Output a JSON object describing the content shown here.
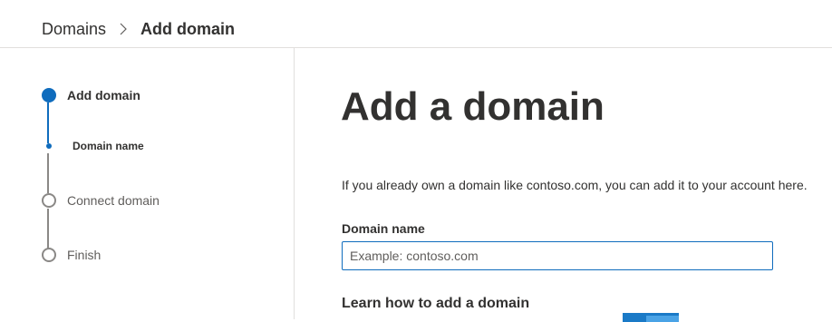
{
  "breadcrumb": {
    "root": "Domains",
    "current": "Add domain"
  },
  "steps": [
    {
      "label": "Add domain",
      "state": "active"
    },
    {
      "label": "Domain name",
      "state": "active-substep"
    },
    {
      "label": "Connect domain",
      "state": "pending"
    },
    {
      "label": "Finish",
      "state": "pending"
    }
  ],
  "main": {
    "title": "Add a domain",
    "description": "If you already own a domain like contoso.com, you can add it to your account here.",
    "field_label": "Domain name",
    "field_placeholder": "Example: contoso.com",
    "field_value": "",
    "learn_heading": "Learn how to add a domain"
  },
  "colors": {
    "accent": "#0f6cbd",
    "inactive": "#8a8886",
    "text": "#323130"
  }
}
